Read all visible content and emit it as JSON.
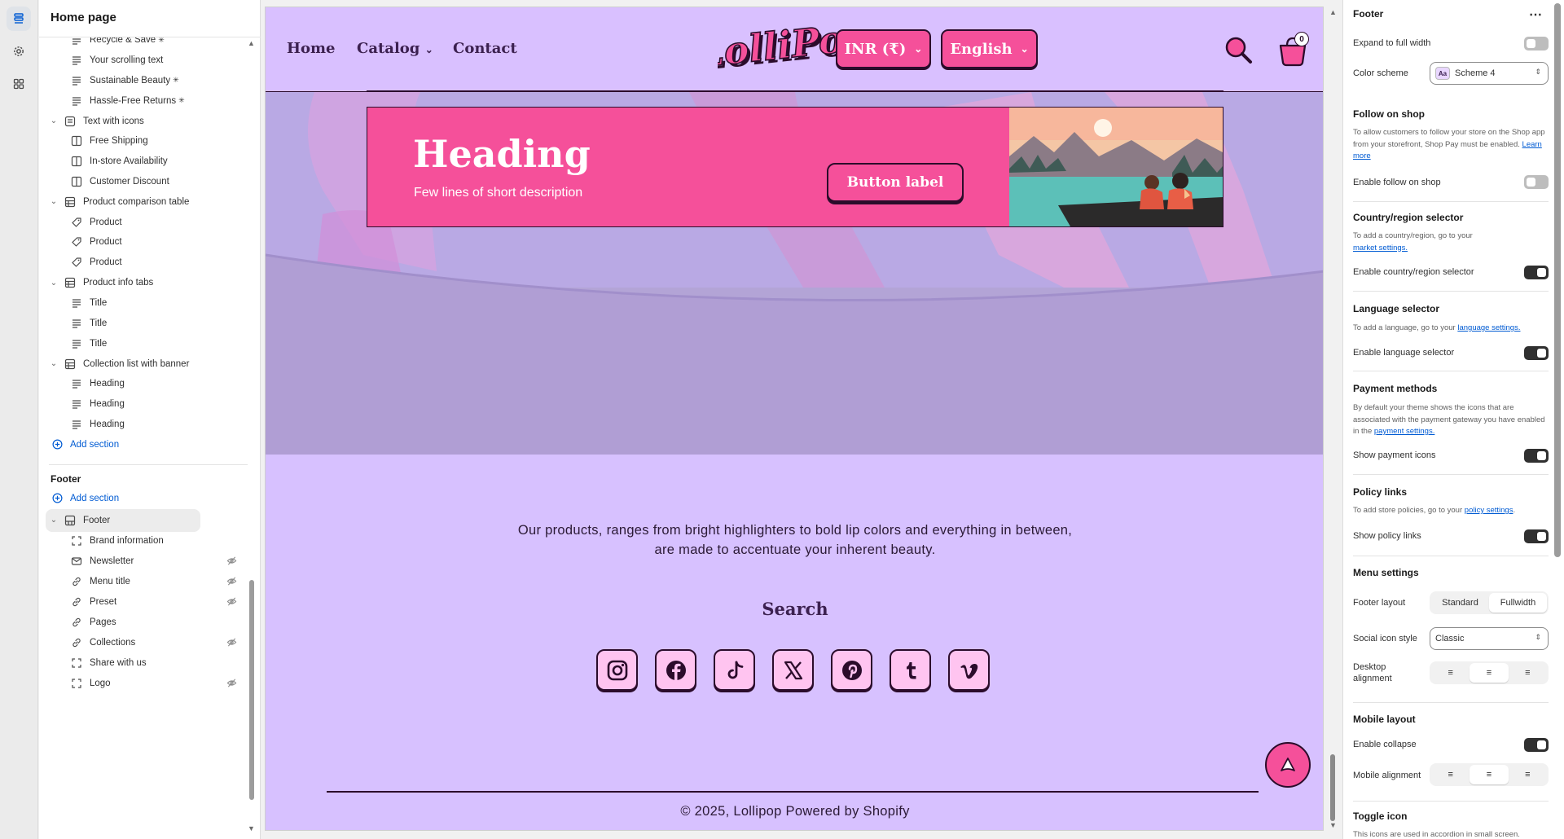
{
  "editor": {
    "page_title": "Home page"
  },
  "tree": {
    "items": [
      {
        "label": "Recycle & Save",
        "level": 2,
        "icon": "text-block-icon",
        "star": true
      },
      {
        "label": "Your scrolling text",
        "level": 2,
        "icon": "text-block-icon"
      },
      {
        "label": "Sustainable Beauty",
        "level": 2,
        "icon": "text-block-icon",
        "star": true
      },
      {
        "label": "Hassle-Free Returns",
        "level": 2,
        "icon": "text-block-icon",
        "star": true
      },
      {
        "label": "Text with icons",
        "level": 1,
        "icon": "section-icon"
      },
      {
        "label": "Free Shipping",
        "level": 2,
        "icon": "column-icon"
      },
      {
        "label": "In-store Availability",
        "level": 2,
        "icon": "column-icon"
      },
      {
        "label": "Customer Discount",
        "level": 2,
        "icon": "column-icon"
      },
      {
        "label": "Product comparison table",
        "level": 1,
        "icon": "table-icon"
      },
      {
        "label": "Product",
        "level": 2,
        "icon": "tag-icon"
      },
      {
        "label": "Product",
        "level": 2,
        "icon": "tag-icon"
      },
      {
        "label": "Product",
        "level": 2,
        "icon": "tag-icon"
      },
      {
        "label": "Product info tabs",
        "level": 1,
        "icon": "table-icon"
      },
      {
        "label": "Title",
        "level": 2,
        "icon": "text-block-icon"
      },
      {
        "label": "Title",
        "level": 2,
        "icon": "text-block-icon"
      },
      {
        "label": "Title",
        "level": 2,
        "icon": "text-block-icon"
      },
      {
        "label": "Collection list with banner",
        "level": 1,
        "icon": "table-icon"
      },
      {
        "label": "Heading",
        "level": 2,
        "icon": "text-block-icon"
      },
      {
        "label": "Heading",
        "level": 2,
        "icon": "text-block-icon"
      },
      {
        "label": "Heading",
        "level": 2,
        "icon": "text-block-icon"
      }
    ],
    "add_section_label": "Add section",
    "footer_group_label": "Footer",
    "footer_add_section_label": "Add section",
    "footer_items": [
      {
        "label": "Footer",
        "level": 1,
        "icon": "layout-icon",
        "selected": true
      },
      {
        "label": "Brand information",
        "level": 2,
        "icon": "frame-icon"
      },
      {
        "label": "Newsletter",
        "level": 2,
        "icon": "mail-icon",
        "hidden": true
      },
      {
        "label": "Menu title",
        "level": 2,
        "icon": "link-icon",
        "hidden": true
      },
      {
        "label": "Preset",
        "level": 2,
        "icon": "link-icon",
        "hidden": true
      },
      {
        "label": "Pages",
        "level": 2,
        "icon": "link-icon"
      },
      {
        "label": "Collections",
        "level": 2,
        "icon": "link-icon",
        "hidden": true
      },
      {
        "label": "Share with us",
        "level": 2,
        "icon": "frame-icon"
      },
      {
        "label": "Logo",
        "level": 2,
        "icon": "frame-icon",
        "hidden": true
      }
    ]
  },
  "store": {
    "nav": [
      "Home",
      "Catalog",
      "Contact"
    ],
    "logo_text": "LolliPop",
    "currency": "INR (₹)",
    "language": "English",
    "cart_count": "0",
    "banner": {
      "heading": "Heading",
      "description": "Few lines of short description",
      "button": "Button label"
    },
    "about_text": "Our products, ranges from bright highlighters to bold lip colors and everything in between, are made to accentuate your inherent beauty.",
    "search_title": "Search",
    "socials": [
      "instagram-icon",
      "facebook-icon",
      "tiktok-icon",
      "x-icon",
      "pinterest-icon",
      "tumblr-icon",
      "vimeo-icon"
    ],
    "copyright": "© 2025, Lollipop Powered by Shopify",
    "colors": {
      "page_bg": "#d7c1ff",
      "accent_pink": "#f5509a",
      "outline": "#2b0c2b",
      "social_bg": "#ffc4f0"
    }
  },
  "settings": {
    "title": "Footer",
    "expand_label": "Expand to full width",
    "expand_on": false,
    "color_scheme_label": "Color scheme",
    "color_scheme_value": "Scheme 4",
    "color_scheme_swatch": "Aa",
    "follow": {
      "heading": "Follow on shop",
      "help": "To allow customers to follow your store on the Shop app from your storefront, Shop Pay must be enabled.",
      "help_link": "Learn more",
      "toggle_label": "Enable follow on shop",
      "on": false
    },
    "country": {
      "heading": "Country/region selector",
      "help": "To add a country/region, go to your",
      "help_link": "market settings.",
      "toggle_label": "Enable country/region selector",
      "on": true
    },
    "language": {
      "heading": "Language selector",
      "help": "To add a language, go to your",
      "help_link": "language settings.",
      "toggle_label": "Enable language selector",
      "on": true
    },
    "payment": {
      "heading": "Payment methods",
      "help": "By default your theme shows the icons that are associated with the payment gateway you have enabled in the",
      "help_link": "payment settings.",
      "toggle_label": "Show payment icons",
      "on": true
    },
    "policy": {
      "heading": "Policy links",
      "help": "To add store policies, go to your",
      "help_link": "policy settings",
      "help_end": ".",
      "toggle_label": "Show policy links",
      "on": true
    },
    "menu": {
      "heading": "Menu settings",
      "layout_label": "Footer layout",
      "layout_options": [
        "Standard",
        "Fullwidth"
      ],
      "layout_selected": "Fullwidth",
      "social_style_label": "Social icon style",
      "social_style_value": "Classic",
      "desktop_align_label": "Desktop alignment",
      "desktop_align_selected": "center"
    },
    "mobile": {
      "heading": "Mobile layout",
      "collapse_label": "Enable collapse",
      "collapse_on": true,
      "align_label": "Mobile alignment",
      "align_selected": "center"
    },
    "toggle_icon": {
      "heading": "Toggle icon",
      "help": "This icons are used in accordion in small screen."
    }
  }
}
